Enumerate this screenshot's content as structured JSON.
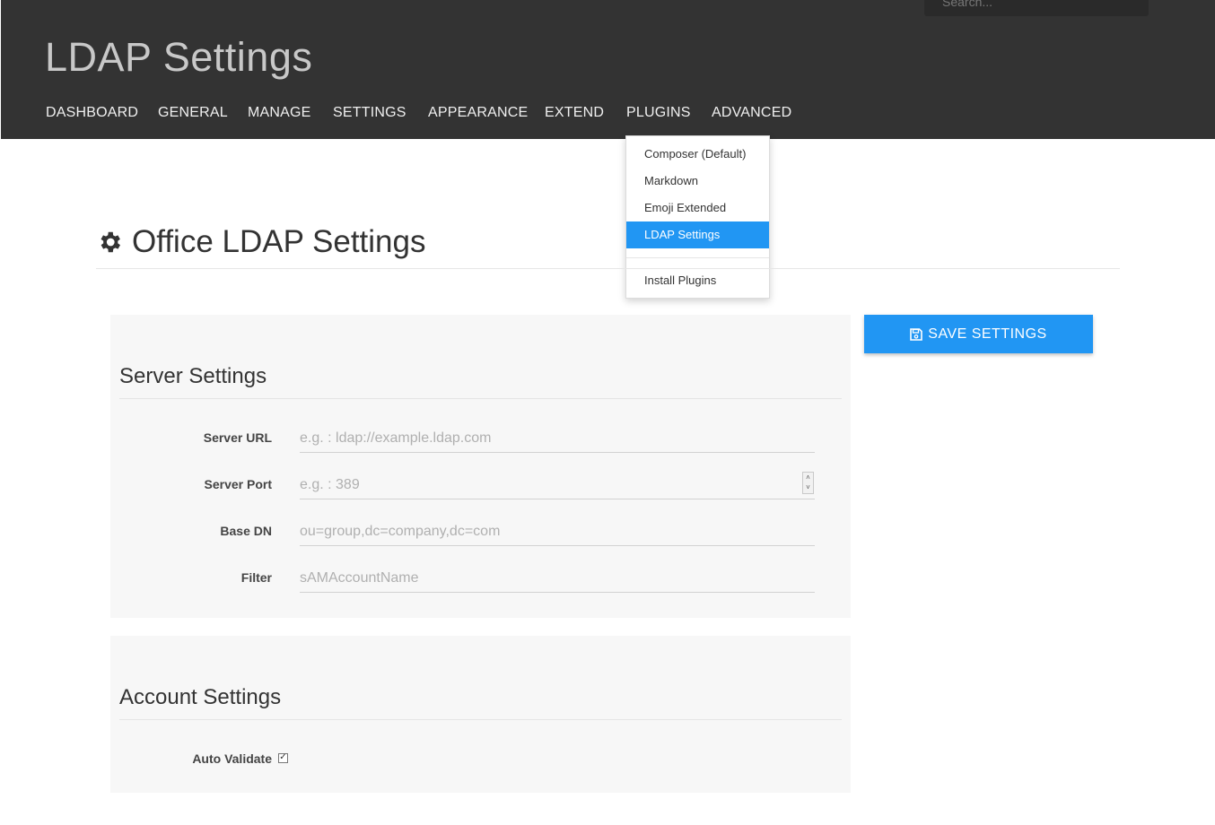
{
  "header": {
    "app_title": "LDAP Settings",
    "search_placeholder": "Search..."
  },
  "nav": {
    "items": [
      "DASHBOARD",
      "GENERAL",
      "MANAGE",
      "SETTINGS",
      "APPEARANCE",
      "EXTEND",
      "PLUGINS",
      "ADVANCED"
    ]
  },
  "plugins_menu": {
    "items": [
      "Composer (Default)",
      "Markdown",
      "Emoji Extended",
      "LDAP Settings"
    ],
    "active": "LDAP Settings",
    "install": "Install Plugins"
  },
  "page": {
    "title": "Office LDAP Settings",
    "title_icon": "gear-icon"
  },
  "server_settings": {
    "heading": "Server Settings",
    "fields": [
      {
        "label": "Server URL",
        "placeholder": "e.g. : ldap://example.ldap.com",
        "value": ""
      },
      {
        "label": "Server Port",
        "placeholder": "e.g. : 389",
        "value": ""
      },
      {
        "label": "Base DN",
        "placeholder": "ou=group,dc=company,dc=com",
        "value": ""
      },
      {
        "label": "Filter",
        "placeholder": "sAMAccountName",
        "value": ""
      }
    ]
  },
  "account_settings": {
    "heading": "Account Settings",
    "auto_validate_label": "Auto Validate",
    "auto_validate_checked": true
  },
  "actions": {
    "save_label": "SAVE SETTINGS",
    "save_icon": "floppy-disk-icon"
  },
  "colors": {
    "header_bg": "#333333",
    "accent": "#2196f3"
  }
}
